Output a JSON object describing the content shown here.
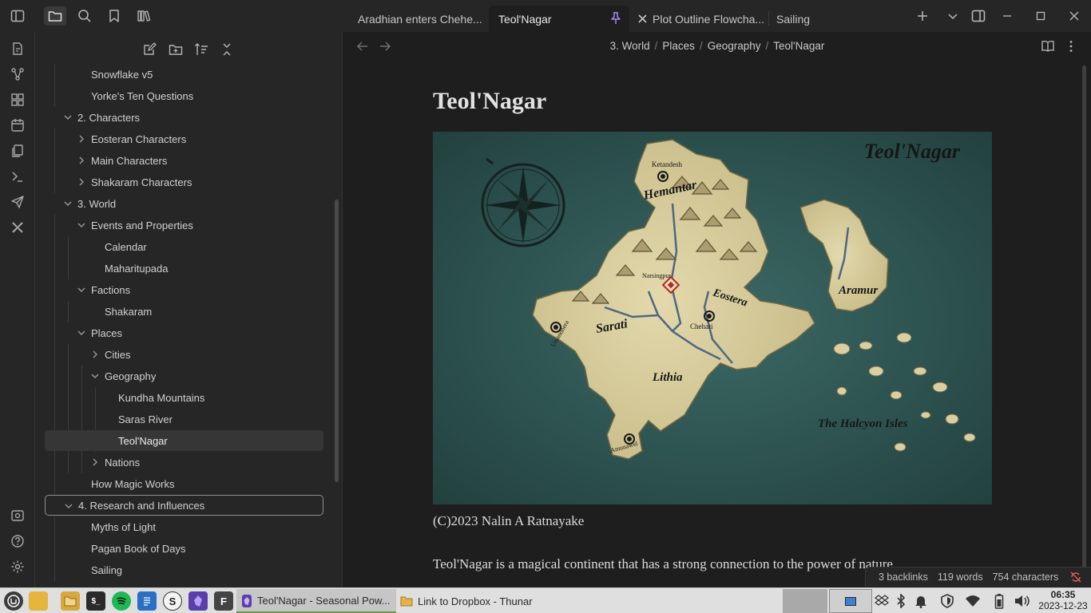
{
  "tabs": [
    {
      "label": "Aradhian enters Chehe...",
      "active": false
    },
    {
      "label": "Teol'Nagar",
      "active": true
    },
    {
      "label": "Plot Outline Flowcha...",
      "active": false
    },
    {
      "label": "Sailing",
      "active": false
    }
  ],
  "tree": [
    {
      "label": "Snowflake v5",
      "depth": 1,
      "chevron": "none"
    },
    {
      "label": "Yorke's Ten Questions",
      "depth": 1,
      "chevron": "none"
    },
    {
      "label": "2. Characters",
      "depth": 0,
      "chevron": "down"
    },
    {
      "label": "Eosteran Characters",
      "depth": 1,
      "chevron": "right"
    },
    {
      "label": "Main Characters",
      "depth": 1,
      "chevron": "right"
    },
    {
      "label": "Shakaram Characters",
      "depth": 1,
      "chevron": "right"
    },
    {
      "label": "3. World",
      "depth": 0,
      "chevron": "down"
    },
    {
      "label": "Events and Properties",
      "depth": 1,
      "chevron": "down"
    },
    {
      "label": "Calendar",
      "depth": 2,
      "chevron": "none"
    },
    {
      "label": "Maharitupada",
      "depth": 2,
      "chevron": "none"
    },
    {
      "label": "Factions",
      "depth": 1,
      "chevron": "down"
    },
    {
      "label": "Shakaram",
      "depth": 2,
      "chevron": "none"
    },
    {
      "label": "Places",
      "depth": 1,
      "chevron": "down"
    },
    {
      "label": "Cities",
      "depth": 2,
      "chevron": "right"
    },
    {
      "label": "Geography",
      "depth": 2,
      "chevron": "down"
    },
    {
      "label": "Kundha Mountains",
      "depth": 3,
      "chevron": "none"
    },
    {
      "label": "Saras River",
      "depth": 3,
      "chevron": "none"
    },
    {
      "label": "Teol'Nagar",
      "depth": 3,
      "chevron": "none",
      "selected": true
    },
    {
      "label": "Nations",
      "depth": 2,
      "chevron": "right"
    },
    {
      "label": "How Magic Works",
      "depth": 1,
      "chevron": "none"
    },
    {
      "label": "4. Research and Influences",
      "depth": 0,
      "chevron": "down",
      "focused": true
    },
    {
      "label": "Myths of Light",
      "depth": 1,
      "chevron": "none"
    },
    {
      "label": "Pagan Book of Days",
      "depth": 1,
      "chevron": "none"
    },
    {
      "label": "Sailing",
      "depth": 1,
      "chevron": "none"
    }
  ],
  "breadcrumb": [
    "3. World",
    "Geography",
    "Places",
    "Teol'Nagar"
  ],
  "breadcrumb_ordered": [
    "3. World",
    "Places",
    "Geography",
    "Teol'Nagar"
  ],
  "note": {
    "title": "Teol'Nagar",
    "caption": "(C)2023 Nalin A Ratnayake",
    "paragraph": "Teol'Nagar is a magical continent that has a strong connection to the power of nature."
  },
  "map": {
    "title": "Teol'Nagar",
    "labels": [
      "Ketandesh",
      "Hemantar",
      "Narsingpur",
      "Eostera",
      "Aramur",
      "Sarati",
      "Utsandhera",
      "Chehari",
      "Lithia",
      "Amunawel",
      "The Halcyon Isles"
    ],
    "sea_color": "#2f5557",
    "land_color": "#d9cfa3"
  },
  "status": {
    "backlinks": "3 backlinks",
    "words": "119 words",
    "characters": "754 characters"
  },
  "taskbar": {
    "windows": [
      {
        "label": "Teol'Nagar - Seasonal Pow...",
        "active": true
      },
      {
        "label": "Link to Dropbox - Thunar",
        "active": false
      }
    ],
    "apps": [
      {
        "name": "terminal",
        "glyph": "$_"
      },
      {
        "name": "obsidian-f",
        "glyph": "F"
      },
      {
        "name": "simplenote",
        "glyph": "S"
      }
    ],
    "time": "06:35",
    "date": "2023-12-23"
  }
}
